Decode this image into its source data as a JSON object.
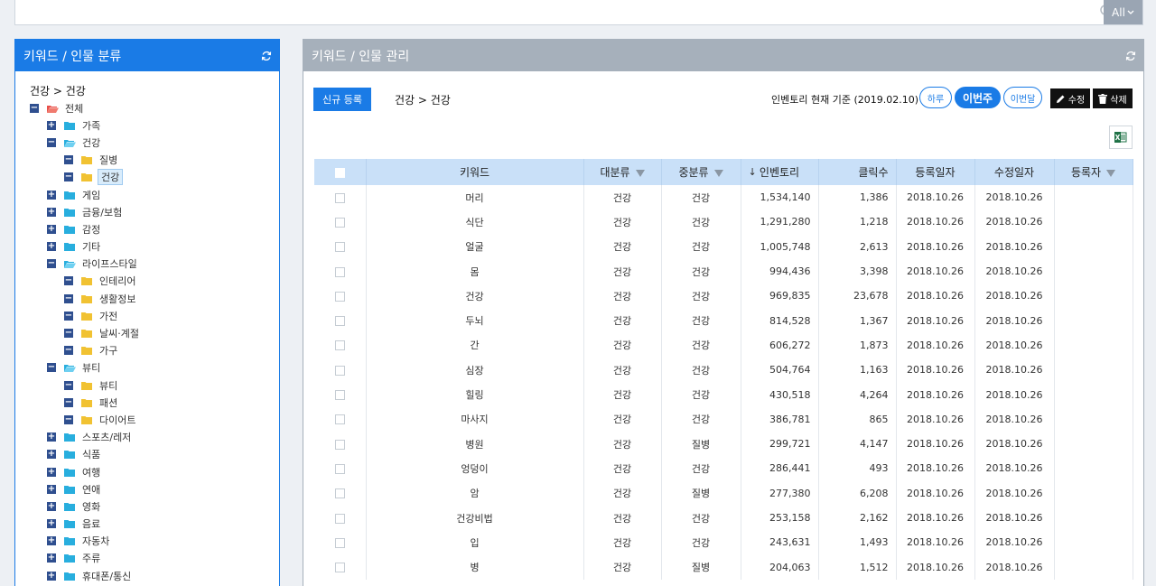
{
  "search": {
    "placeholder": "",
    "scope_label": "All"
  },
  "left": {
    "title": "키워드 / 인물 분류",
    "path": "건강 > 건강",
    "tree": [
      {
        "label": "전체",
        "depth": 0,
        "toggle": "−",
        "folder": "open-red"
      },
      {
        "label": "가족",
        "depth": 1,
        "toggle": "+",
        "folder": "closed-cyan"
      },
      {
        "label": "건강",
        "depth": 1,
        "toggle": "−",
        "folder": "open-cyan"
      },
      {
        "label": "질병",
        "depth": 2,
        "toggle": "−",
        "folder": "closed-yellow"
      },
      {
        "label": "건강",
        "depth": 2,
        "toggle": "−",
        "folder": "closed-yellow",
        "selected": true
      },
      {
        "label": "게임",
        "depth": 1,
        "toggle": "+",
        "folder": "closed-cyan"
      },
      {
        "label": "금융/보험",
        "depth": 1,
        "toggle": "+",
        "folder": "closed-cyan"
      },
      {
        "label": "감정",
        "depth": 1,
        "toggle": "+",
        "folder": "closed-cyan"
      },
      {
        "label": "기타",
        "depth": 1,
        "toggle": "+",
        "folder": "closed-cyan"
      },
      {
        "label": "라이프스타일",
        "depth": 1,
        "toggle": "−",
        "folder": "open-cyan"
      },
      {
        "label": "인테리어",
        "depth": 2,
        "toggle": "−",
        "folder": "closed-yellow"
      },
      {
        "label": "생활정보",
        "depth": 2,
        "toggle": "−",
        "folder": "closed-yellow"
      },
      {
        "label": "가전",
        "depth": 2,
        "toggle": "−",
        "folder": "closed-yellow"
      },
      {
        "label": "날씨·계절",
        "depth": 2,
        "toggle": "−",
        "folder": "closed-yellow"
      },
      {
        "label": "가구",
        "depth": 2,
        "toggle": "−",
        "folder": "closed-yellow"
      },
      {
        "label": "뷰티",
        "depth": 1,
        "toggle": "−",
        "folder": "open-cyan"
      },
      {
        "label": "뷰티",
        "depth": 2,
        "toggle": "−",
        "folder": "closed-yellow"
      },
      {
        "label": "패션",
        "depth": 2,
        "toggle": "−",
        "folder": "closed-yellow"
      },
      {
        "label": "다이어트",
        "depth": 2,
        "toggle": "−",
        "folder": "closed-yellow"
      },
      {
        "label": "스포츠/레저",
        "depth": 1,
        "toggle": "+",
        "folder": "closed-cyan"
      },
      {
        "label": "식품",
        "depth": 1,
        "toggle": "+",
        "folder": "closed-cyan"
      },
      {
        "label": "여행",
        "depth": 1,
        "toggle": "+",
        "folder": "closed-cyan"
      },
      {
        "label": "연애",
        "depth": 1,
        "toggle": "+",
        "folder": "closed-cyan"
      },
      {
        "label": "영화",
        "depth": 1,
        "toggle": "+",
        "folder": "closed-cyan"
      },
      {
        "label": "음료",
        "depth": 1,
        "toggle": "+",
        "folder": "closed-cyan"
      },
      {
        "label": "자동차",
        "depth": 1,
        "toggle": "+",
        "folder": "closed-cyan"
      },
      {
        "label": "주류",
        "depth": 1,
        "toggle": "+",
        "folder": "closed-cyan"
      },
      {
        "label": "휴대폰/통신",
        "depth": 1,
        "toggle": "+",
        "folder": "closed-cyan"
      }
    ]
  },
  "right": {
    "title": "키워드 / 인물 관리",
    "new_label": "신규 등록",
    "crumb": "건강 > 건강",
    "inventory_label": "인벤토리 현재 기준 (2019.02.10)",
    "period": {
      "day": "하루",
      "week": "이번주",
      "month": "이번달"
    },
    "edit_label": "수정",
    "delete_label": "삭제",
    "columns": [
      "키워드",
      "대분류",
      "중분류",
      "인벤토리",
      "클릭수",
      "등록일자",
      "수정일자",
      "등록자"
    ],
    "rows": [
      [
        "머리",
        "건강",
        "건강",
        "1,534,140",
        "1,386",
        "2018.10.26",
        "2018.10.26",
        ""
      ],
      [
        "식단",
        "건강",
        "건강",
        "1,291,280",
        "1,218",
        "2018.10.26",
        "2018.10.26",
        ""
      ],
      [
        "얼굴",
        "건강",
        "건강",
        "1,005,748",
        "2,613",
        "2018.10.26",
        "2018.10.26",
        ""
      ],
      [
        "몸",
        "건강",
        "건강",
        "994,436",
        "3,398",
        "2018.10.26",
        "2018.10.26",
        ""
      ],
      [
        "건강",
        "건강",
        "건강",
        "969,835",
        "23,678",
        "2018.10.26",
        "2018.10.26",
        ""
      ],
      [
        "두뇌",
        "건강",
        "건강",
        "814,528",
        "1,367",
        "2018.10.26",
        "2018.10.26",
        ""
      ],
      [
        "간",
        "건강",
        "건강",
        "606,272",
        "1,873",
        "2018.10.26",
        "2018.10.26",
        ""
      ],
      [
        "심장",
        "건강",
        "건강",
        "504,764",
        "1,163",
        "2018.10.26",
        "2018.10.26",
        ""
      ],
      [
        "힐링",
        "건강",
        "건강",
        "430,518",
        "4,264",
        "2018.10.26",
        "2018.10.26",
        ""
      ],
      [
        "마사지",
        "건강",
        "건강",
        "386,781",
        "865",
        "2018.10.26",
        "2018.10.26",
        ""
      ],
      [
        "병원",
        "건강",
        "질병",
        "299,721",
        "4,147",
        "2018.10.26",
        "2018.10.26",
        ""
      ],
      [
        "엉덩이",
        "건강",
        "건강",
        "286,441",
        "493",
        "2018.10.26",
        "2018.10.26",
        ""
      ],
      [
        "암",
        "건강",
        "질병",
        "277,380",
        "6,208",
        "2018.10.26",
        "2018.10.26",
        ""
      ],
      [
        "건강비법",
        "건강",
        "건강",
        "253,158",
        "2,162",
        "2018.10.26",
        "2018.10.26",
        ""
      ],
      [
        "입",
        "건강",
        "건강",
        "243,631",
        "1,493",
        "2018.10.26",
        "2018.10.26",
        ""
      ],
      [
        "병",
        "건강",
        "질병",
        "204,063",
        "1,512",
        "2018.10.26",
        "2018.10.26",
        ""
      ]
    ]
  },
  "colors": {
    "primary": "#1a7be6",
    "header_gray": "#a6b0bb",
    "table_head": "#c9e0f8"
  }
}
